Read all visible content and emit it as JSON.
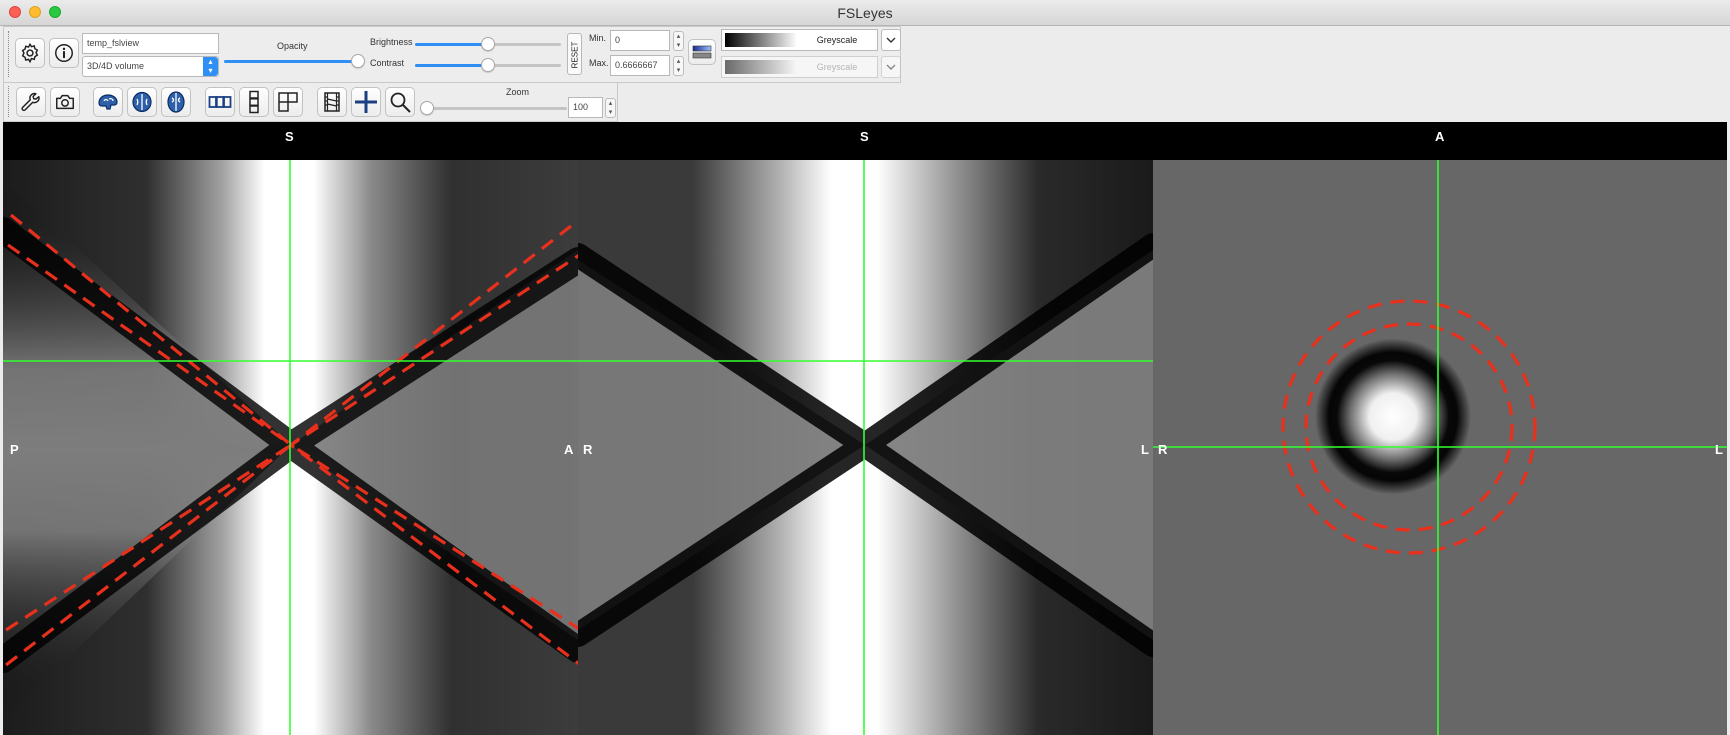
{
  "window": {
    "title": "FSLeyes"
  },
  "overlay_toolbar": {
    "overlay_name": "temp_fslview",
    "overlay_type": "3D/4D volume",
    "opacity_label": "Opacity",
    "opacity_value": 1.0,
    "brightness_label": "Brightness",
    "brightness_value": 0.5,
    "contrast_label": "Contrast",
    "contrast_value": 0.5,
    "reset_label": "RESET",
    "min_label": "Min.",
    "min_value": "0",
    "max_label": "Max.",
    "max_value": "0.6666667",
    "colormap_label": "Greyscale",
    "neg_colormap_label": "Greyscale"
  },
  "ortho_toolbar": {
    "zoom_label": "Zoom",
    "zoom_value": "100",
    "zoom_fraction": 0.0
  },
  "views": {
    "sagittal": {
      "top_label": "S",
      "left_label": "P",
      "right_label": "A"
    },
    "coronal": {
      "top_label": "S",
      "left_label": "R",
      "right_label": "L"
    },
    "axial": {
      "top_label": "A",
      "left_label": "R",
      "right_label": "L"
    }
  },
  "colors": {
    "cursor": "#33ff33",
    "contour": "#e8301c",
    "accent": "#2f8ff4"
  },
  "icons": [
    "gear-icon",
    "info-icon",
    "wrench-icon",
    "camera-icon",
    "sagittal-brain-icon",
    "coronal-brain-icon",
    "axial-brain-icon",
    "horizontal-layout-icon",
    "vertical-layout-icon",
    "grid-layout-icon",
    "movie-icon",
    "crosshair-icon",
    "zoom-icon"
  ]
}
